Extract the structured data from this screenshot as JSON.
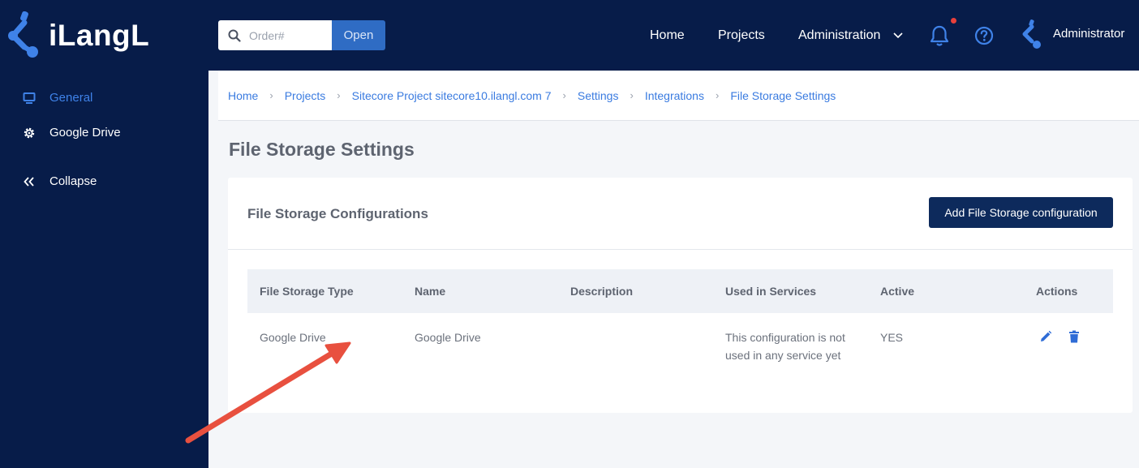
{
  "brand": {
    "name": "iLangL"
  },
  "search": {
    "placeholder": "Order#",
    "value": "",
    "button_label": "Open"
  },
  "topnav": {
    "home": "Home",
    "projects": "Projects",
    "administration": "Administration",
    "user": "Administrator"
  },
  "sidebar": {
    "items": [
      {
        "label": "General",
        "icon": "monitor-icon",
        "active": true
      },
      {
        "label": "Google Drive",
        "icon": "gear-icon",
        "active": false
      },
      {
        "label": "Collapse",
        "icon": "double-chevron-left-icon",
        "active": false
      }
    ]
  },
  "breadcrumb": [
    "Home",
    "Projects",
    "Sitecore Project sitecore10.ilangl.com 7",
    "Settings",
    "Integrations",
    "File Storage Settings"
  ],
  "page": {
    "title": "File Storage Settings"
  },
  "card": {
    "title": "File Storage Configurations",
    "add_button": "Add File Storage configuration"
  },
  "table": {
    "columns": [
      "File Storage Type",
      "Name",
      "Description",
      "Used in Services",
      "Active",
      "Actions"
    ],
    "rows": [
      {
        "type": "Google Drive",
        "name": "Google Drive",
        "description": "",
        "used_in_services": "This configuration is not used in any service yet",
        "active": "YES"
      }
    ]
  },
  "colors": {
    "navy": "#071c49",
    "accent_blue": "#3a7be0",
    "button_navy": "#0d2a5c",
    "annotation_arrow": "#e8503f"
  }
}
